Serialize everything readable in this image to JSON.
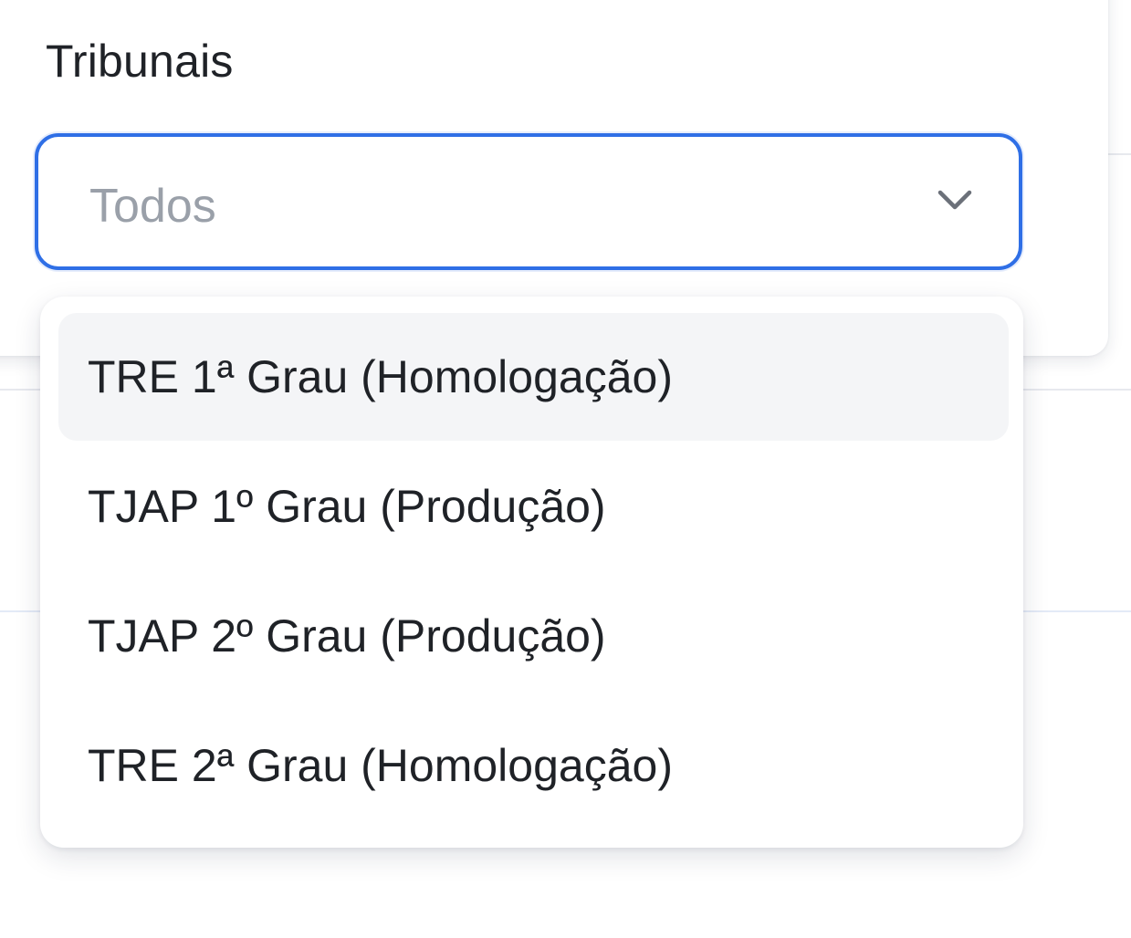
{
  "filter": {
    "label": "Tribunais",
    "select": {
      "value": "Todos",
      "icon": "chevron-down-icon",
      "focus_color": "#2f6fe6"
    }
  },
  "dropdown": {
    "options": [
      {
        "label": "TRE 1ª Grau (Homologação)",
        "highlighted": true
      },
      {
        "label": "TJAP 1º Grau (Produção)"
      },
      {
        "label": "TJAP 2º Grau (Produção)"
      },
      {
        "label": "TRE 2ª Grau (Homologação)"
      }
    ]
  }
}
